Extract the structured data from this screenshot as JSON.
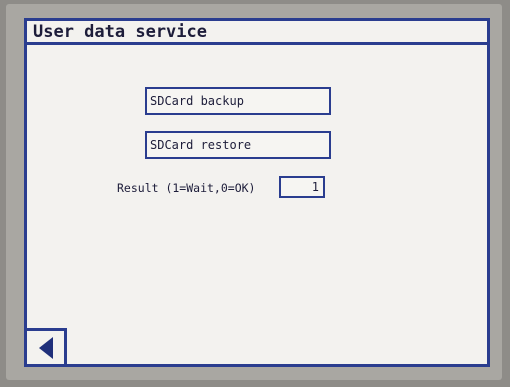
{
  "screen": {
    "title": "User data service",
    "backup_button_label": "SDCard backup",
    "restore_button_label": "SDCard restore",
    "result_label": "Result (1=Wait,0=OK)",
    "result_value": "1",
    "back_button_icon": "back-arrow-icon"
  },
  "colors": {
    "frame": "#2a3d8f",
    "background": "#f3f2ef",
    "text": "#1d1d3a"
  }
}
